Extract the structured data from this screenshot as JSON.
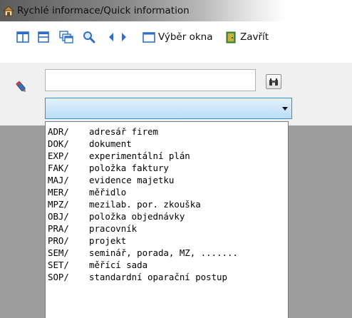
{
  "window": {
    "title": "Rychlé informace/Quick information"
  },
  "toolbar": {
    "window_select_label": "Výběr okna",
    "close_label": "Zavřít"
  },
  "search": {
    "value": "",
    "placeholder": ""
  },
  "combo": {
    "selected": ""
  },
  "dropdown": {
    "items": [
      {
        "code": "ADR/",
        "label": "adresář firem"
      },
      {
        "code": "DOK/",
        "label": "dokument"
      },
      {
        "code": "EXP/",
        "label": "experimentální plán"
      },
      {
        "code": "FAK/",
        "label": "položka faktury"
      },
      {
        "code": "MAJ/",
        "label": "evidence majetku"
      },
      {
        "code": "MER/",
        "label": "měřidlo"
      },
      {
        "code": "MPZ/",
        "label": "mezilab. por. zkouška"
      },
      {
        "code": "OBJ/",
        "label": "položka objednávky"
      },
      {
        "code": "PRA/",
        "label": "pracovník"
      },
      {
        "code": "PRO/",
        "label": "projekt"
      },
      {
        "code": "SEM/",
        "label": "seminář, porada, MZ, ......."
      },
      {
        "code": "SET/",
        "label": "měřící sada"
      },
      {
        "code": "SOP/",
        "label": "standardní oparační postup"
      }
    ]
  },
  "colors": {
    "accent_blue": "#3a8ed6",
    "toolbar_icon_blue": "#2f6fc9",
    "panel_gray": "#f0f0f0",
    "background_dark_gray": "#9d9d9d"
  },
  "icons": {
    "app": "app-window-icon",
    "split_vertical": "split-vertical-icon",
    "split_horizontal": "split-horizontal-icon",
    "cascade": "cascade-windows-icon",
    "zoom": "magnifier-icon",
    "prev": "arrow-left-icon",
    "next": "arrow-right-icon",
    "window_select": "window-select-icon",
    "close": "exit-door-icon",
    "pen": "pen-icon",
    "search": "binoculars-icon"
  }
}
